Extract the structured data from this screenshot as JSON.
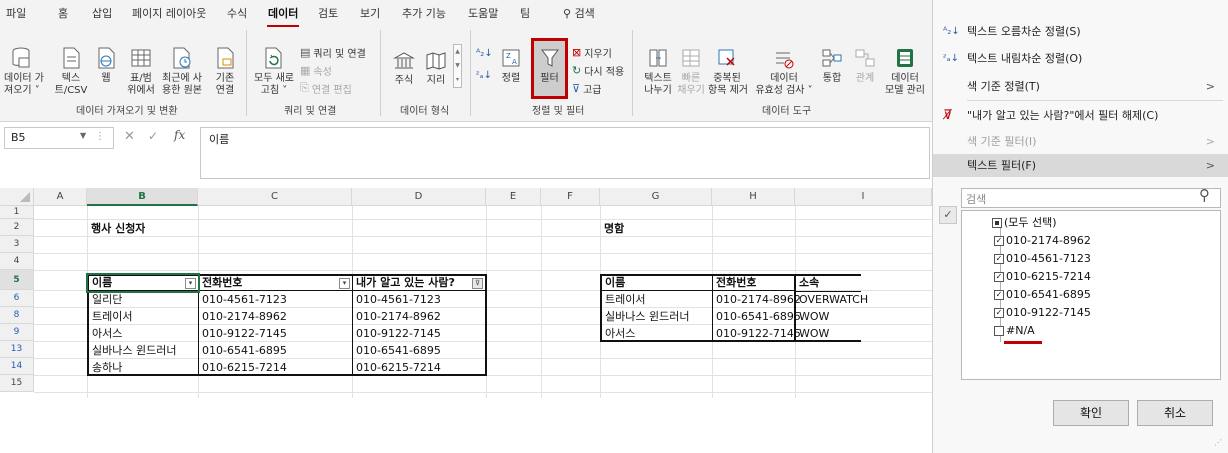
{
  "ribbon": {
    "tabs": [
      "파일",
      "홈",
      "삽입",
      "페이지 레이아웃",
      "수식",
      "데이터",
      "검토",
      "보기",
      "추가 기능",
      "도움말",
      "팀",
      "검색"
    ],
    "active_tab": "데이터",
    "get_data": {
      "line1": "데이터 가",
      "line2": "져오기 ˅"
    },
    "text_csv": {
      "line1": "텍스",
      "line2": "트/CSV"
    },
    "web": {
      "line1": "웹",
      "line2": ""
    },
    "from_table": {
      "line1": "표/범",
      "line2": "위에서"
    },
    "recent_sources": {
      "line1": "최근에 사",
      "line2": "용한 원본"
    },
    "existing_conn": {
      "line1": "기존",
      "line2": "연결"
    },
    "group_get_transform": "데이터 가져오기 및 변환",
    "refresh_all": {
      "line1": "모두 새로",
      "line2": "고침 ˅"
    },
    "queries_connections": "쿼리 및 연결",
    "properties": "속성",
    "edit_links": "연결 편집",
    "group_queries": "쿼리 및 연결",
    "stocks": "주식",
    "geography": "지리",
    "group_data_types": "데이터 형식",
    "sort": "정렬",
    "filter": "필터",
    "clear": "지우기",
    "reapply": "다시 적용",
    "advanced": "고급",
    "group_sort_filter": "정렬 및 필터",
    "text_to_columns": {
      "line1": "텍스트",
      "line2": "나누기"
    },
    "flash_fill": {
      "line1": "빠른",
      "line2": "채우기"
    },
    "remove_duplicates": {
      "line1": "중복된",
      "line2": "항목 제거"
    },
    "data_validation": {
      "line1": "데이터",
      "line2": "유효성 검사 ˅"
    },
    "consolidate": "통합",
    "relationships": "관계",
    "data_model": {
      "line1": "데이터",
      "line2": "모델 관리"
    },
    "group_data_tools": "데이터 도구"
  },
  "formula_bar": {
    "name_box": "B5",
    "cancel": "✕",
    "enter": "✓",
    "fx": "fx",
    "content": "이름"
  },
  "grid": {
    "columns": [
      "A",
      "B",
      "C",
      "D",
      "E",
      "F",
      "G",
      "H",
      "I"
    ],
    "rows": [
      "1",
      "2",
      "3",
      "4",
      "5",
      "6",
      "8",
      "9",
      "13",
      "14",
      "15"
    ],
    "title_left": "행사 신청자",
    "title_right": "명함",
    "left_table": {
      "headers": [
        "이름",
        "전화번호",
        "내가 알고 있는 사람?"
      ],
      "rows": [
        [
          "일리단",
          "010-4561-7123",
          "010-4561-7123"
        ],
        [
          "트레이서",
          "010-2174-8962",
          "010-2174-8962"
        ],
        [
          "아서스",
          "010-9122-7145",
          "010-9122-7145"
        ],
        [
          "실바나스 윈드러너",
          "010-6541-6895",
          "010-6541-6895"
        ],
        [
          "송하나",
          "010-6215-7214",
          "010-6215-7214"
        ]
      ]
    },
    "right_table": {
      "headers": [
        "이름",
        "전화번호",
        "소속"
      ],
      "rows": [
        [
          "트레이서",
          "010-2174-8962",
          "OVERWATCH"
        ],
        [
          "실바나스 윈드러너",
          "010-6541-6895",
          "WOW"
        ],
        [
          "아서스",
          "010-9122-7145",
          "WOW"
        ]
      ]
    }
  },
  "filter_panel": {
    "sort_asc": "텍스트 오름차순 정렬(S)",
    "sort_desc": "텍스트 내림차순 정렬(O)",
    "sort_by_color": "색 기준 정렬(T)",
    "clear_filter": "\"내가 알고 있는 사람?\"에서 필터 해제(C)",
    "filter_by_color": "색 기준 필터(I)",
    "text_filters": "텍스트 필터(F)",
    "search_placeholder": "검색",
    "items": [
      {
        "label": "(모두 선택)",
        "state": "partial"
      },
      {
        "label": "010-2174-8962",
        "state": "checked"
      },
      {
        "label": "010-4561-7123",
        "state": "checked"
      },
      {
        "label": "010-6215-7214",
        "state": "checked"
      },
      {
        "label": "010-6541-6895",
        "state": "checked"
      },
      {
        "label": "010-9122-7145",
        "state": "checked"
      },
      {
        "label": "#N/A",
        "state": "unchecked"
      }
    ],
    "ok": "확인",
    "cancel": "취소"
  },
  "colors": {
    "highlight_red": "#c00000",
    "excel_green": "#217346",
    "filtered_row_blue": "#1f5fb4"
  }
}
